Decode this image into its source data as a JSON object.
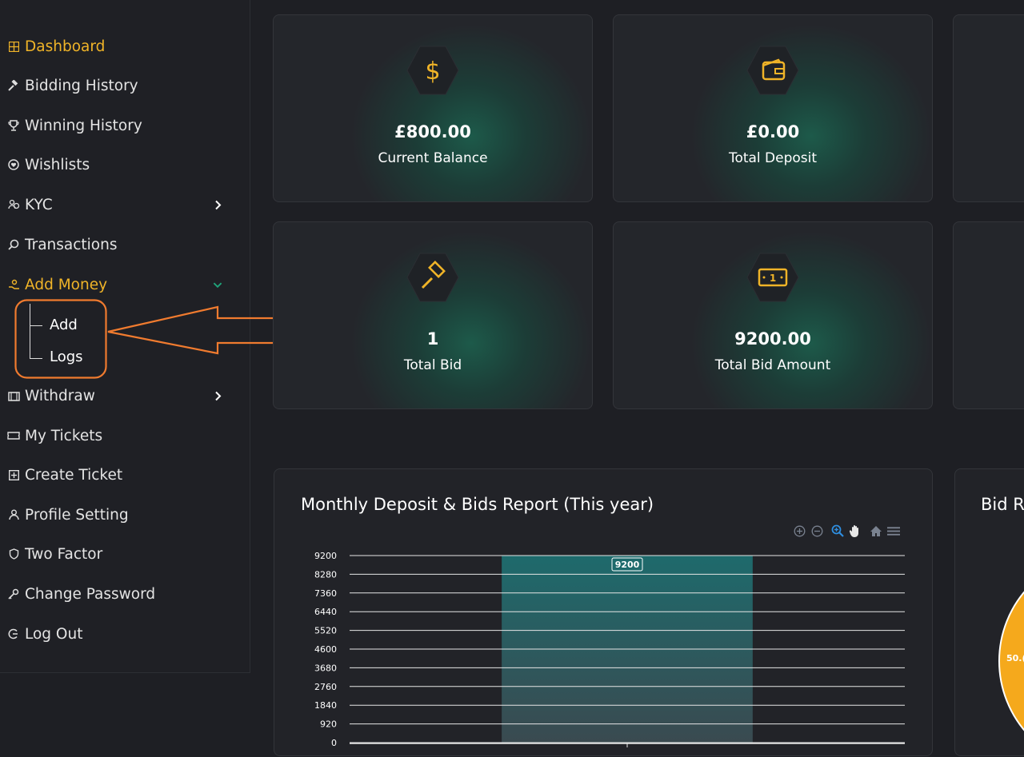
{
  "sidebar": {
    "items": [
      {
        "label": "Dashboard",
        "icon": "dashboard-icon"
      },
      {
        "label": "Bidding History",
        "icon": "hammer-icon"
      },
      {
        "label": "Winning History",
        "icon": "trophy-icon"
      },
      {
        "label": "Wishlists",
        "icon": "heart-icon"
      },
      {
        "label": "KYC",
        "icon": "users-icon"
      },
      {
        "label": "Transactions",
        "icon": "search-icon"
      },
      {
        "label": "Add Money",
        "icon": "hand-money-icon"
      },
      {
        "label": "Withdraw",
        "icon": "wallet-icon"
      },
      {
        "label": "My Tickets",
        "icon": "ticket-icon"
      },
      {
        "label": "Create Ticket",
        "icon": "plus-square-icon"
      },
      {
        "label": "Profile Setting",
        "icon": "user-icon"
      },
      {
        "label": "Two Factor",
        "icon": "shield-icon"
      },
      {
        "label": "Change Password",
        "icon": "key-icon"
      },
      {
        "label": "Log Out",
        "icon": "logout-icon"
      }
    ],
    "submenu": {
      "add": "Add",
      "logs": "Logs"
    }
  },
  "cards": [
    {
      "value": "£800.00",
      "label": "Current Balance",
      "icon": "dollar-icon"
    },
    {
      "value": "£0.00",
      "label": "Total Deposit",
      "icon": "wallet-icon"
    },
    {
      "value": "1",
      "label": "Total Bid",
      "icon": "gavel-icon"
    },
    {
      "value": "9200.00",
      "label": "Total Bid Amount",
      "icon": "money-bill-icon"
    }
  ],
  "chart": {
    "title": "Monthly Deposit & Bids Report (This year)",
    "toolbar": [
      "zoom-in-icon",
      "zoom-out-icon",
      "zoom-select-icon",
      "pan-hand-icon",
      "home-icon",
      "menu-icon"
    ]
  },
  "chart_data": {
    "type": "bar",
    "title": "Monthly Deposit & Bids Report (This year)",
    "yticks": [
      "9200",
      "8280",
      "7360",
      "6440",
      "5520",
      "4600",
      "3680",
      "2760",
      "1840",
      "920",
      "0"
    ],
    "ylim": [
      0,
      9200
    ],
    "series": [
      {
        "values": [
          9200
        ]
      }
    ],
    "data_labels": [
      "9200"
    ],
    "grid": true
  },
  "side_chart": {
    "title": "Bid R",
    "slice_label": "50.("
  },
  "colors": {
    "accent": "#f0b428",
    "bar": "#1e6a6c",
    "annotation": "#f07b2f"
  }
}
